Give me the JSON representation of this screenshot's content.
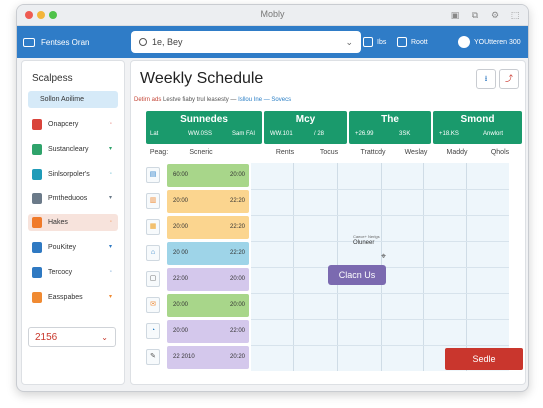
{
  "window": {
    "title": "Mobly"
  },
  "toolbar": {
    "left_label": "Fentses Oran",
    "search_value": "1e, Bey",
    "btn1_label": "Ibs",
    "btn2_label": "Roott",
    "user_label": "YOUtteren 300"
  },
  "sidebar": {
    "title": "Scalpess",
    "active_label": "Sollon Aoilime",
    "items": [
      {
        "label": "Onapcery",
        "icon": "red-square-icon",
        "color": "#d9433a"
      },
      {
        "label": "Sustancleary",
        "icon": "green-square-icon",
        "color": "#2fa36b"
      },
      {
        "label": "Sinlsorpoler's",
        "icon": "teal-square-icon",
        "color": "#1f9bb8"
      },
      {
        "label": "Pmtheduoos",
        "icon": "gray-square-icon",
        "color": "#6b7a89"
      },
      {
        "label": "Hakes",
        "icon": "orange-square-icon",
        "color": "#f07a2a"
      },
      {
        "label": "PouKitey",
        "icon": "blue-square-icon",
        "color": "#2f79c2"
      },
      {
        "label": "Tercocy",
        "icon": "blue-square-icon",
        "color": "#2f79c2"
      },
      {
        "label": "Easspabes",
        "icon": "orange-square-icon",
        "color": "#f08a32"
      }
    ],
    "footer_value": "2156"
  },
  "main": {
    "title": "Weekly Schedule",
    "sub_red": "Detirn ads",
    "sub_gray": "Lestve fiaby trul leasesty —",
    "sub_blue": "Isllou Ine — Sovecs",
    "header_cols": [
      {
        "title": "Sunnedes",
        "left": "Lat",
        "mid": "WW.0SS",
        "right": "Sam FAI"
      },
      {
        "title": "Mcy",
        "left": "",
        "mid": "WW.101",
        "right": "/ 28"
      },
      {
        "title": "The",
        "left": "",
        "mid": "+26.99",
        "right": "3SK"
      },
      {
        "title": "Smond",
        "left": "",
        "mid": "+18.KS",
        "right": "Anwlort"
      }
    ],
    "subheaders": [
      "Peag:",
      "Scneric",
      "Rents",
      "Tocus",
      "Trattcdy",
      "Weslay",
      "Maddy",
      "Qhols"
    ],
    "rows": [
      {
        "start": "60:00",
        "end": "20:00",
        "color": "#a8d68a",
        "icon": "chart-icon"
      },
      {
        "start": "20:00",
        "end": "22:20",
        "color": "#fbd58f",
        "icon": "document-icon"
      },
      {
        "start": "20:00",
        "end": "22:20",
        "color": "#fbd58f",
        "icon": "clipboard-icon"
      },
      {
        "start": "20 00",
        "end": "22:20",
        "color": "#9ed4e8",
        "icon": "home-icon"
      },
      {
        "start": "22:00",
        "end": "20:00",
        "color": "#d4c8ec",
        "icon": "chat-icon"
      },
      {
        "start": "20:00",
        "end": "20:00",
        "color": "#a8d68a",
        "icon": "mail-icon"
      },
      {
        "start": "20:00",
        "end": "22:00",
        "color": "#d4c8ec",
        "icon": "clock-icon"
      },
      {
        "start": "22 2010",
        "end": "20:20",
        "color": "#d4c8ec",
        "icon": "edit-icon"
      }
    ],
    "popup_l1": "Caece+ Nerlgs",
    "popup_l2": "Oluneer",
    "clean_button": "Clacn Us",
    "save_button": "Sedle",
    "ctrl1_icon": "download-icon",
    "ctrl2_icon": "export-icon"
  }
}
